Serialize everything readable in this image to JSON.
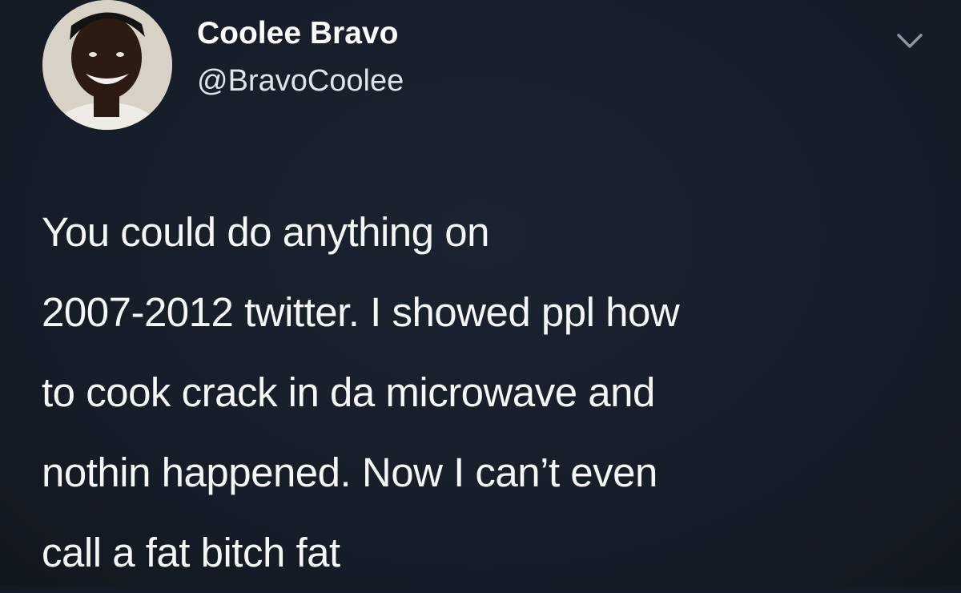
{
  "author": {
    "display_name": "Coolee Bravo",
    "handle": "@BravoCoolee"
  },
  "icons": {
    "menu": "chevron-down-icon",
    "avatar": "profile-photo"
  },
  "tweet": {
    "lines": [
      "You could do anything on",
      "2007-2012 twitter. I showed ppl how",
      "to cook crack in da microwave and",
      "nothin happened. Now I can’t even",
      "call a fat bitch fat"
    ]
  },
  "colors": {
    "background": "#161c27",
    "text": "#f4f6f8",
    "secondary_text": "#dfe4ea"
  }
}
